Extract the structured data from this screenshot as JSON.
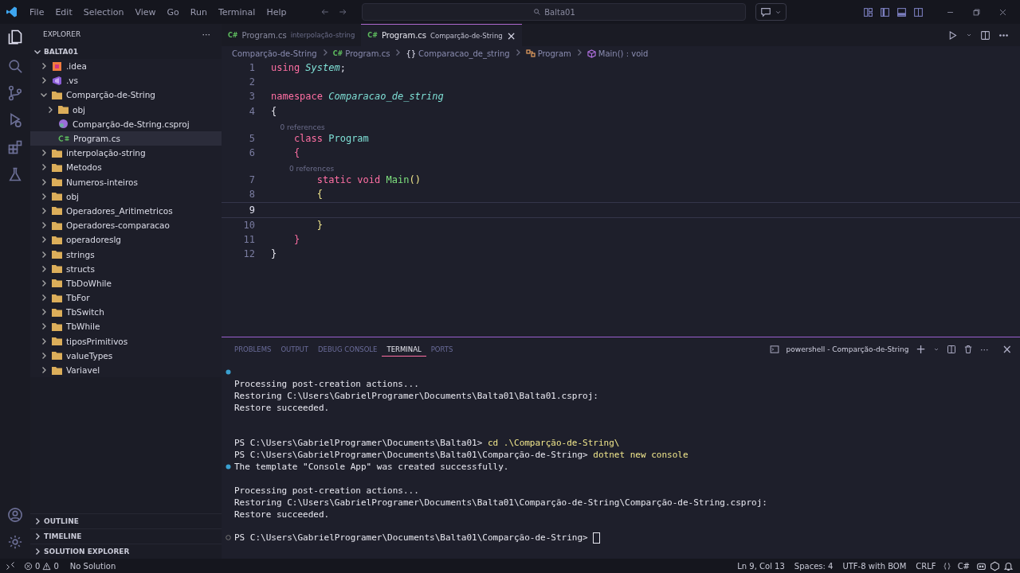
{
  "menu": [
    "File",
    "Edit",
    "Selection",
    "View",
    "Go",
    "Run",
    "Terminal",
    "Help"
  ],
  "search": {
    "value": "Balta01"
  },
  "sidebar": {
    "title": "EXPLORER",
    "more": "···",
    "root": {
      "label": "BALTA01",
      "expanded": true
    },
    "tree": [
      {
        "label": ".idea",
        "kind": "idea",
        "expanded": false,
        "selected": false
      },
      {
        "label": ".vs",
        "kind": "vs",
        "expanded": false,
        "selected": false
      },
      {
        "label": "Comparção-de-String",
        "kind": "folder",
        "expanded": true,
        "selected": false,
        "children": [
          {
            "label": "obj",
            "kind": "folder",
            "expanded": false,
            "selected": false
          },
          {
            "label": "Comparção-de-String.csproj",
            "kind": "csproj",
            "selected": false
          },
          {
            "label": "Program.cs",
            "kind": "csharp",
            "selected": true
          }
        ]
      },
      {
        "label": "interpolação-string",
        "kind": "folder",
        "expanded": false,
        "selected": false
      },
      {
        "label": "Metodos",
        "kind": "folder",
        "expanded": false,
        "selected": false
      },
      {
        "label": "Numeros-inteiros",
        "kind": "folder",
        "expanded": false,
        "selected": false
      },
      {
        "label": "obj",
        "kind": "folder",
        "expanded": false,
        "selected": false
      },
      {
        "label": "Operadores_Aritimetricos",
        "kind": "folder",
        "expanded": false,
        "selected": false
      },
      {
        "label": "Operadores-comparacao",
        "kind": "folder",
        "expanded": false,
        "selected": false
      },
      {
        "label": "operadoreslg",
        "kind": "folder",
        "expanded": false,
        "selected": false
      },
      {
        "label": "strings",
        "kind": "folder",
        "expanded": false,
        "selected": false
      },
      {
        "label": "structs",
        "kind": "folder",
        "expanded": false,
        "selected": false
      },
      {
        "label": "TbDoWhile",
        "kind": "folder",
        "expanded": false,
        "selected": false
      },
      {
        "label": "TbFor",
        "kind": "folder",
        "expanded": false,
        "selected": false
      },
      {
        "label": "TbSwitch",
        "kind": "folder",
        "expanded": false,
        "selected": false
      },
      {
        "label": "TbWhile",
        "kind": "folder",
        "expanded": false,
        "selected": false
      },
      {
        "label": "tiposPrimitivos",
        "kind": "folder",
        "expanded": false,
        "selected": false
      },
      {
        "label": "valueTypes",
        "kind": "folder",
        "expanded": false,
        "selected": false
      },
      {
        "label": "Variavel",
        "kind": "folder",
        "expanded": false,
        "selected": false
      }
    ],
    "sections": [
      {
        "label": "OUTLINE",
        "expanded": false
      },
      {
        "label": "TIMELINE",
        "expanded": false
      },
      {
        "label": "SOLUTION EXPLORER",
        "expanded": false
      }
    ]
  },
  "tabs": [
    {
      "label": "Program.cs",
      "description": "interpolação-string",
      "icon_text": "C#",
      "selected": false
    },
    {
      "label": "Program.cs",
      "description": "Comparção-de-String",
      "icon_text": "C#",
      "selected": true,
      "close": "×"
    }
  ],
  "breadcrumb": [
    {
      "label": "Comparção-de-String",
      "kind": "folder"
    },
    {
      "label": "Program.cs",
      "kind": "csharp",
      "icon_text": "C#"
    },
    {
      "label": "Comparacao_de_string",
      "kind": "namespace",
      "icon_text": "{}"
    },
    {
      "label": "Program",
      "kind": "class"
    },
    {
      "label": "Main() : void",
      "kind": "method"
    }
  ],
  "code": [
    {
      "number": "1",
      "current": false,
      "tokens": [
        {
          "kind": "keyword",
          "text": "using "
        },
        {
          "kind": "type",
          "text": "System"
        },
        {
          "kind": "plain",
          "text": ";"
        }
      ]
    },
    {
      "number": "2",
      "current": false
    },
    {
      "number": "3",
      "current": false,
      "tokens": [
        {
          "kind": "keyword",
          "text": "namespace "
        },
        {
          "kind": "type",
          "text": "Comparacao_de_string"
        }
      ]
    },
    {
      "number": "4",
      "current": false,
      "tokens": [
        {
          "kind": "brace1",
          "text": "{"
        }
      ]
    },
    {
      "number": "5",
      "current": false,
      "codelens": "0 references",
      "tokens": [
        {
          "kind": "keyword",
          "text": "    class "
        },
        {
          "kind": "class",
          "text": "Program"
        }
      ]
    },
    {
      "number": "6",
      "current": false,
      "tokens": [
        {
          "kind": "brace2",
          "text": "    {"
        }
      ]
    },
    {
      "number": "7",
      "current": false,
      "codelens": "0 references",
      "tokens": [
        {
          "kind": "keyword",
          "text": "        static void "
        },
        {
          "kind": "function",
          "text": "Main"
        },
        {
          "kind": "brace3",
          "text": "()"
        }
      ]
    },
    {
      "number": "8",
      "current": false,
      "tokens": [
        {
          "kind": "brace3",
          "text": "        {"
        }
      ]
    },
    {
      "number": "9",
      "current": true
    },
    {
      "number": "10",
      "current": false,
      "tokens": [
        {
          "kind": "brace3",
          "text": "        }"
        }
      ]
    },
    {
      "number": "11",
      "current": false,
      "tokens": [
        {
          "kind": "brace2",
          "text": "    }"
        }
      ]
    },
    {
      "number": "12",
      "current": false,
      "tokens": [
        {
          "kind": "brace1",
          "text": "}"
        }
      ]
    }
  ],
  "panel": {
    "tabs": [
      {
        "label": "PROBLEMS",
        "selected": false
      },
      {
        "label": "OUTPUT",
        "selected": false
      },
      {
        "label": "DEBUG CONSOLE",
        "selected": false
      },
      {
        "label": "TERMINAL",
        "selected": true
      },
      {
        "label": "PORTS",
        "selected": false
      }
    ],
    "terminal_name": "powershell - Comparção-de-String",
    "add": "+",
    "more": "···",
    "close": "×",
    "lines": [
      {
        "kind": "success"
      },
      {
        "kind": "output",
        "text": "Processing post-creation actions..."
      },
      {
        "kind": "output",
        "text": "Restoring C:\\Users\\GabrielProgramer\\Documents\\Balta01\\Balta01.csproj:"
      },
      {
        "kind": "output",
        "text": "Restore succeeded."
      },
      {
        "kind": "blank"
      },
      {
        "kind": "blank"
      },
      {
        "kind": "prompt",
        "prompt": "PS C:\\Users\\GabrielProgramer\\Documents\\Balta01>",
        "command": "cd .\\Comparção-de-String\\"
      },
      {
        "kind": "prompt",
        "prompt": "PS C:\\Users\\GabrielProgramer\\Documents\\Balta01\\Comparção-de-String>",
        "command": "dotnet new console"
      },
      {
        "kind": "success",
        "text": "The template \"Console App\" was created successfully."
      },
      {
        "kind": "blank"
      },
      {
        "kind": "output",
        "text": "Processing post-creation actions..."
      },
      {
        "kind": "output",
        "text": "Restoring C:\\Users\\GabrielProgramer\\Documents\\Balta01\\Comparção-de-String\\Comparção-de-String.csproj:"
      },
      {
        "kind": "output",
        "text": "Restore succeeded."
      },
      {
        "kind": "blank"
      },
      {
        "kind": "pending",
        "prompt": "PS C:\\Users\\GabrielProgramer\\Documents\\Balta01\\Comparção-de-String>",
        "cursor": true
      }
    ]
  },
  "status_bar": {
    "problems": [
      {
        "kind": "error",
        "count": "0"
      },
      {
        "kind": "warning",
        "count": "0"
      }
    ],
    "solution": "No Solution",
    "right": [
      "Ln 9, Col 13",
      "Spaces: 4",
      "UTF-8 with BOM",
      "CRLF",
      "C#"
    ]
  }
}
